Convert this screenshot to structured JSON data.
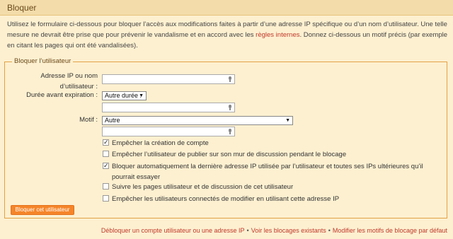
{
  "header": {
    "title": "Bloquer"
  },
  "intro": {
    "text_before": "Utilisez le formulaire ci-dessous pour bloquer l’accès aux modifications faites à partir d’une adresse IP spécifique ou d’un nom d’utilisateur. Une telle mesure ne devrait être prise que pour prévenir le vandalisme et en accord avec les ",
    "link": "règles internes",
    "text_after": ". Donnez ci-dessous un motif précis (par exemple en citant les pages qui ont été vandalisées)."
  },
  "form": {
    "legend": "Bloquer l’utilisateur",
    "ip_label_line1": "Adresse IP ou nom",
    "ip_label_line2": "d’utilisateur :",
    "ip_value": "",
    "expiry_label": "Durée avant expiration :",
    "expiry_selected": "Autre durée :",
    "expiry_other_value": "",
    "reason_label": "Motif :",
    "reason_selected": "Autre",
    "reason_other_value": "",
    "options": [
      {
        "label": "Empêcher la création de compte",
        "checked": true
      },
      {
        "label": "Empêcher l’utilisateur de publier sur son mur de discussion pendant le blocage",
        "checked": false
      },
      {
        "label": "Bloquer automatiquement la dernière adresse IP utilisée par l’utilisateur et toutes ses IPs ultérieures qu’il pourrait essayer",
        "checked": true
      },
      {
        "label": "Suivre les pages utilisateur et de discussion de cet utilisateur",
        "checked": false
      },
      {
        "label": "Empêcher les utilisateurs connectés de modifier en utilisant cette adresse IP",
        "checked": false
      }
    ],
    "submit_label": "Bloquer cet utilisateur"
  },
  "footer": {
    "links": [
      "Débloquer un compte utilisateur ou une adresse IP",
      "Voir les blocages existants",
      "Modifier les motifs de blocage par défaut"
    ],
    "separator": "•"
  }
}
